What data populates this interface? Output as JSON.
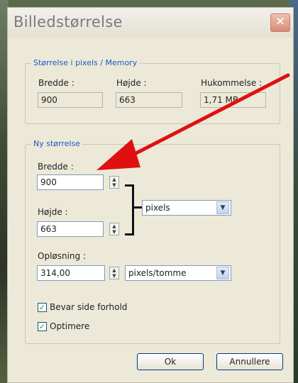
{
  "dialog": {
    "title": "Billedstørrelse",
    "close_glyph": "✕"
  },
  "current_size": {
    "group_label": "Størrelse i pixels / Memory",
    "width_label": "Bredde :",
    "width_value": "900",
    "height_label": "Højde :",
    "height_value": "663",
    "memory_label": "Hukommelse :",
    "memory_value": "1,71 MB"
  },
  "new_size": {
    "group_label": "Ny størrelse",
    "width_label": "Bredde :",
    "width_value": "900",
    "height_label": "Højde :",
    "height_value": "663",
    "unit_selected": "pixels",
    "resolution_label": "Opløsning :",
    "resolution_value": "314,00",
    "resolution_unit_selected": "pixels/tomme",
    "keep_ratio_label": "Bevar side forhold",
    "keep_ratio_checked": true,
    "optimize_label": "Optimere",
    "optimize_checked": true
  },
  "buttons": {
    "ok_label": "Ok",
    "cancel_label": "Annullere"
  },
  "annotation": {
    "arrow_color": "#e01010"
  }
}
